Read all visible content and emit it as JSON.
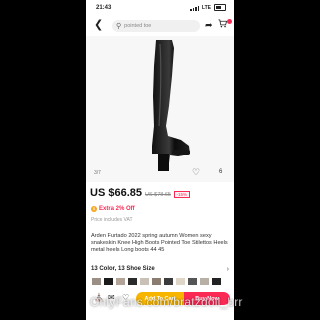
{
  "status_bar": {
    "time": "21:43",
    "network": "LTE"
  },
  "nav": {
    "search_placeholder": "pointed toe"
  },
  "gallery": {
    "counter": "3/7",
    "wish_count": "6"
  },
  "product": {
    "price": "US $66.85",
    "old_price": "US $78.65",
    "discount": "-15%",
    "extra_discount": "Extra 2% Off",
    "vat_note": "Price includes VAT",
    "title": "Arden Furtado 2022 spring autumn Women sexy snakeskin Knee High Boots Pointed Toe Stilettos Heels metal heels Long boots 44 45",
    "variants": "13 Color, 13 Shoe Size"
  },
  "bottom": {
    "add_to_cart": "Add To Cart",
    "buy_now": "Buy Now"
  },
  "watermark": "OnlyFans.com/bratzdoll_brr",
  "colors": {
    "accent": "#fa2a55",
    "cart_button": "#f7b500"
  }
}
